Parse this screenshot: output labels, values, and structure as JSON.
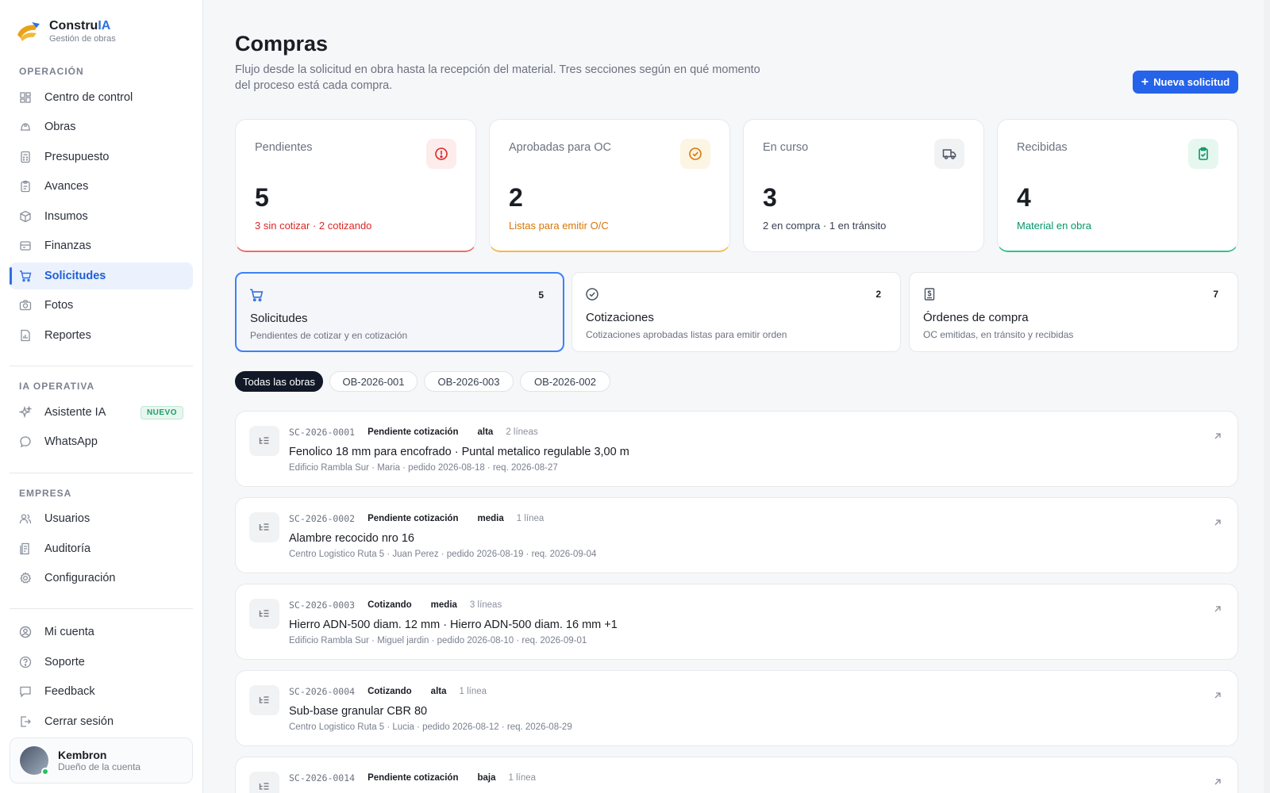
{
  "brand": {
    "name_main": "Constru",
    "name_accent": "IA",
    "subtitle": "Gestión de obras"
  },
  "sidebar": {
    "sections": {
      "operacion": "OPERACIÓN",
      "ia": "IA OPERATIVA",
      "empresa": "EMPRESA"
    },
    "operacion_items": [
      {
        "label": "Centro de control",
        "icon": "grid-icon"
      },
      {
        "label": "Obras",
        "icon": "helmet-icon"
      },
      {
        "label": "Presupuesto",
        "icon": "calculator-icon"
      },
      {
        "label": "Avances",
        "icon": "clipboard-icon"
      },
      {
        "label": "Insumos",
        "icon": "box-icon"
      },
      {
        "label": "Finanzas",
        "icon": "wallet-icon"
      },
      {
        "label": "Solicitudes",
        "icon": "cart-icon",
        "active": true
      },
      {
        "label": "Fotos",
        "icon": "camera-icon"
      },
      {
        "label": "Reportes",
        "icon": "report-icon"
      }
    ],
    "ia_items": [
      {
        "label": "Asistente IA",
        "icon": "sparkle-icon",
        "badge": "NUEVO"
      },
      {
        "label": "WhatsApp",
        "icon": "chat-icon"
      }
    ],
    "empresa_items": [
      {
        "label": "Usuarios",
        "icon": "users-icon"
      },
      {
        "label": "Auditoría",
        "icon": "audit-icon"
      },
      {
        "label": "Configuración",
        "icon": "gear-icon"
      }
    ],
    "footer_items": [
      {
        "label": "Mi cuenta",
        "icon": "user-circle-icon"
      },
      {
        "label": "Soporte",
        "icon": "help-icon"
      },
      {
        "label": "Feedback",
        "icon": "message-icon"
      },
      {
        "label": "Cerrar sesión",
        "icon": "logout-icon"
      }
    ],
    "user": {
      "name": "Kembron",
      "role": "Dueño de la cuenta"
    }
  },
  "header": {
    "title": "Compras",
    "description": "Flujo desde la solicitud en obra hasta la recepción del material. Tres secciones según en qué momento del proceso está cada compra.",
    "new_button": "Nueva solicitud"
  },
  "stats": [
    {
      "label": "Pendientes",
      "value": "5",
      "sub": "3 sin cotizar · 2 cotizando",
      "color": "#dc2626",
      "icon": "alert-icon"
    },
    {
      "label": "Aprobadas para OC",
      "value": "2",
      "sub": "Listas para emitir O/C",
      "color": "#d97706",
      "icon": "check-circle-icon"
    },
    {
      "label": "En curso",
      "value": "3",
      "sub": "2 en compra · 1 en tránsito",
      "color": "#374151",
      "icon": "truck-icon"
    },
    {
      "label": "Recibidas",
      "value": "4",
      "sub": "Material en obra",
      "color": "#059669",
      "icon": "clipboard-check-icon"
    }
  ],
  "tabs": [
    {
      "title": "Solicitudes",
      "sub": "Pendientes de cotizar y en cotización",
      "count": "5",
      "icon": "cart-icon"
    },
    {
      "title": "Cotizaciones",
      "sub": "Cotizaciones aprobadas listas para emitir orden",
      "count": "2",
      "icon": "check-circle-icon"
    },
    {
      "title": "Órdenes de compra",
      "sub": "OC emitidas, en tránsito y recibidas",
      "count": "7",
      "icon": "receipt-icon"
    }
  ],
  "filters": [
    "Todas las obras",
    "OB-2026-001",
    "OB-2026-003",
    "OB-2026-002"
  ],
  "requests": [
    {
      "code": "SC-2026-0001",
      "status": "Pendiente cotización",
      "priority": "alta",
      "lines": "2 líneas",
      "title": "Fenolico 18 mm para encofrado · Puntal metalico regulable 3,00 m",
      "detail": "Edificio Rambla Sur · Maria · pedido 2026-08-18 · req. 2026-08-27"
    },
    {
      "code": "SC-2026-0002",
      "status": "Pendiente cotización",
      "priority": "media",
      "lines": "1 línea",
      "title": "Alambre recocido nro 16",
      "detail": "Centro Logistico Ruta 5 · Juan Perez · pedido 2026-08-19 · req. 2026-09-04"
    },
    {
      "code": "SC-2026-0003",
      "status": "Cotizando",
      "priority": "media",
      "lines": "3 líneas",
      "title": "Hierro ADN-500 diam. 12 mm · Hierro ADN-500 diam. 16 mm +1",
      "detail": "Edificio Rambla Sur · Miguel jardin · pedido 2026-08-10 · req. 2026-09-01"
    },
    {
      "code": "SC-2026-0004",
      "status": "Cotizando",
      "priority": "alta",
      "lines": "1 línea",
      "title": "Sub-base granular CBR 80",
      "detail": "Centro Logistico Ruta 5 · Lucia · pedido 2026-08-12 · req. 2026-08-29"
    },
    {
      "code": "SC-2026-0014",
      "status": "Pendiente cotización",
      "priority": "baja",
      "lines": "1 línea",
      "title": "",
      "detail": ""
    }
  ]
}
